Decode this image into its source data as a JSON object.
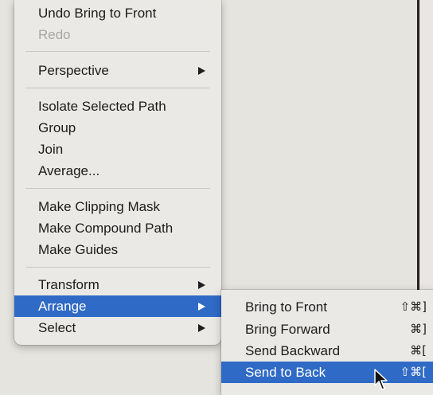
{
  "context_menu": {
    "items": [
      {
        "label": "Undo Bring to Front"
      },
      {
        "label": "Redo"
      },
      {
        "label": "Perspective"
      },
      {
        "label": "Isolate Selected Path"
      },
      {
        "label": "Group"
      },
      {
        "label": "Join"
      },
      {
        "label": "Average..."
      },
      {
        "label": "Make Clipping Mask"
      },
      {
        "label": "Make Compound Path"
      },
      {
        "label": "Make Guides"
      },
      {
        "label": "Transform"
      },
      {
        "label": "Arrange"
      },
      {
        "label": "Select"
      }
    ]
  },
  "arrange_submenu": {
    "items": [
      {
        "label": "Bring to Front",
        "shortcut": "⇧⌘]"
      },
      {
        "label": "Bring Forward",
        "shortcut": "⌘]"
      },
      {
        "label": "Send Backward",
        "shortcut": "⌘["
      },
      {
        "label": "Send to Back",
        "shortcut": "⇧⌘["
      }
    ]
  },
  "colors": {
    "menu_background": "#ebe9e6",
    "highlight": "#2f6ac6",
    "disabled_text": "#a7a6a4"
  }
}
